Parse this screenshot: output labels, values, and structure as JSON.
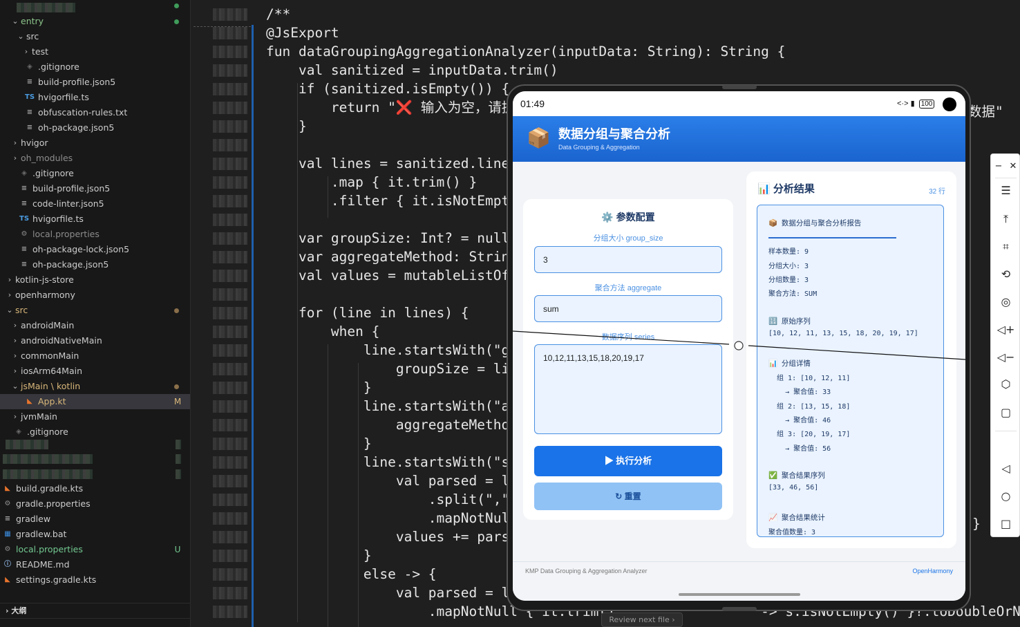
{
  "file_tree": {
    "items": [
      {
        "label": "entry",
        "indent": 1,
        "chevron": "open",
        "icon": "",
        "status_dot": "#3f9c5a",
        "color": "#8bc48a"
      },
      {
        "label": "src",
        "indent": 2,
        "chevron": "open",
        "icon": ""
      },
      {
        "label": "test",
        "indent": 3,
        "chevron": "closed",
        "icon": ""
      },
      {
        "label": ".gitignore",
        "indent": 2,
        "chevron": "",
        "icon": "gitignore"
      },
      {
        "label": "build-profile.json5",
        "indent": 2,
        "chevron": "",
        "icon": "lines"
      },
      {
        "label": "hvigorfile.ts",
        "indent": 2,
        "chevron": "",
        "icon": "ts"
      },
      {
        "label": "obfuscation-rules.txt",
        "indent": 2,
        "chevron": "",
        "icon": "lines"
      },
      {
        "label": "oh-package.json5",
        "indent": 2,
        "chevron": "",
        "icon": "lines"
      },
      {
        "label": "hvigor",
        "indent": 1,
        "chevron": "closed",
        "icon": ""
      },
      {
        "label": "oh_modules",
        "indent": 1,
        "chevron": "closed",
        "icon": "",
        "color": "#8c8c8c"
      },
      {
        "label": ".gitignore",
        "indent": 1,
        "chevron": "",
        "icon": "gitignore"
      },
      {
        "label": "build-profile.json5",
        "indent": 1,
        "chevron": "",
        "icon": "lines"
      },
      {
        "label": "code-linter.json5",
        "indent": 1,
        "chevron": "",
        "icon": "lines"
      },
      {
        "label": "hvigorfile.ts",
        "indent": 1,
        "chevron": "",
        "icon": "ts"
      },
      {
        "label": "local.properties",
        "indent": 1,
        "chevron": "",
        "icon": "gear",
        "color": "#8c8c8c"
      },
      {
        "label": "oh-package-lock.json5",
        "indent": 1,
        "chevron": "",
        "icon": "lines"
      },
      {
        "label": "oh-package.json5",
        "indent": 1,
        "chevron": "",
        "icon": "lines"
      },
      {
        "label": "kotlin-js-store",
        "indent": 0,
        "chevron": "closed",
        "icon": ""
      },
      {
        "label": "openharmony",
        "indent": 0,
        "chevron": "closed",
        "icon": ""
      },
      {
        "label": "src",
        "indent": 0,
        "chevron": "open",
        "icon": "",
        "status_dot": "#8a6f4a",
        "color": "#d9b77a"
      },
      {
        "label": "androidMain",
        "indent": 1,
        "chevron": "closed",
        "icon": ""
      },
      {
        "label": "androidNativeMain",
        "indent": 1,
        "chevron": "closed",
        "icon": ""
      },
      {
        "label": "commonMain",
        "indent": 1,
        "chevron": "closed",
        "icon": ""
      },
      {
        "label": "iosArm64Main",
        "indent": 1,
        "chevron": "closed",
        "icon": ""
      },
      {
        "label": "jsMain \\ kotlin",
        "indent": 1,
        "chevron": "open",
        "icon": "",
        "status_dot": "#8a6f4a",
        "color": "#d9b77a"
      },
      {
        "label": "App.kt",
        "indent": 2,
        "chevron": "",
        "icon": "kotlin",
        "git": "M",
        "color": "#d9b77a",
        "selected": true
      },
      {
        "label": "jvmMain",
        "indent": 1,
        "chevron": "closed",
        "icon": ""
      },
      {
        "label": ".gitignore",
        "indent": 0,
        "chevron": "",
        "icon": "gitignore"
      }
    ],
    "items_bottom": [
      {
        "label": "build.gradle.kts",
        "icon": "kotlin"
      },
      {
        "label": "gradle.properties",
        "icon": "gear"
      },
      {
        "label": "gradlew",
        "icon": "lines"
      },
      {
        "label": "gradlew.bat",
        "icon": "win"
      },
      {
        "label": "local.properties",
        "icon": "gear",
        "git": "U",
        "color": "#73c991"
      },
      {
        "label": "README.md",
        "icon": "info"
      },
      {
        "label": "settings.gradle.kts",
        "icon": "kotlin"
      }
    ],
    "outline_label": "大纲"
  },
  "editor": {
    "lines": [
      "/**",
      "@JsExport",
      "fun dataGroupingAggregationAnalyzer(inputData: String): String {",
      "    val sanitized = inputData.trim()",
      "    if (sanitized.isEmpty()) {",
      "        return \"❌ 输入为空，请提",
      "    }",
      "",
      "    val lines = sanitized.lines(",
      "        .map { it.trim() }",
      "        .filter { it.isNotEmpty(",
      "",
      "    var groupSize: Int? = null",
      "    var aggregateMethod: String?",
      "    val values = mutableListOf<D",
      "",
      "    for (line in lines) {",
      "        when {",
      "            line.startsWith(\"gro",
      "                groupSize = line",
      "            }",
      "            line.startsWith(\"agg",
      "                aggregateMethod",
      "            }",
      "            line.startsWith(\"ser",
      "                val parsed = lin",
      "                    .split(\",\",",
      "                    .mapNotNull",
      "                values += parsed",
      "            }",
      "            else -> {",
      "                val parsed = lin",
      "                    .mapNotNull { it.trim().                 -> s.isNotEmpty() }?.toDoubleOrNull() }"
    ],
    "right_fragments": [
      "数据\"",
      "}"
    ],
    "review_label": "Review next file  ›"
  },
  "phone": {
    "status": {
      "time": "01:49",
      "icons": "<·> ▮",
      "battery": "100"
    },
    "header": {
      "icon": "📦",
      "title": "数据分组与聚合分析",
      "subtitle": "Data Grouping & Aggregation"
    },
    "config": {
      "title": "⚙️ 参数配置",
      "group_label": "分组大小 group_size",
      "group_value": "3",
      "method_label": "聚合方法 aggregate",
      "method_value": "sum",
      "series_label": "数据序列 series",
      "series_value": "10,12,11,13,15,18,20,19,17",
      "run_button": "▶ 执行分析",
      "reset_button": "↻ 重置"
    },
    "results": {
      "title": "📊 分析结果",
      "count": "32 行",
      "report": [
        {
          "text": "📦  数据分组与聚合分析报告",
          "kind": "head"
        },
        {
          "text": "",
          "kind": "rule"
        },
        {
          "text": "样本数量: 9",
          "kind": "line"
        },
        {
          "text": "分组大小: 3",
          "kind": "line"
        },
        {
          "text": "分组数量: 3",
          "kind": "line"
        },
        {
          "text": "聚合方法: SUM",
          "kind": "line"
        },
        {
          "text": "",
          "kind": "blank"
        },
        {
          "text": "🔢  原始序列",
          "kind": "head"
        },
        {
          "text": "[10, 12, 11, 13, 15, 18, 20, 19, 17]",
          "kind": "line"
        },
        {
          "text": "",
          "kind": "blank"
        },
        {
          "text": "📊  分组详情",
          "kind": "head"
        },
        {
          "text": "  组 1: [10, 12, 11]",
          "kind": "line"
        },
        {
          "text": "    → 聚合值: 33",
          "kind": "line"
        },
        {
          "text": "  组 2: [13, 15, 18]",
          "kind": "line"
        },
        {
          "text": "    → 聚合值: 46",
          "kind": "line"
        },
        {
          "text": "  组 3: [20, 19, 17]",
          "kind": "line"
        },
        {
          "text": "    → 聚合值: 56",
          "kind": "line"
        },
        {
          "text": "",
          "kind": "blank"
        },
        {
          "text": "✅  聚合结果序列",
          "kind": "head"
        },
        {
          "text": "[33, 46, 56]",
          "kind": "line"
        },
        {
          "text": "",
          "kind": "blank"
        },
        {
          "text": "📈  聚合结果统计",
          "kind": "head"
        },
        {
          "text": "聚合值数量: 3",
          "kind": "line"
        }
      ]
    },
    "footer": {
      "left": "KMP Data Grouping & Aggregation Analyzer",
      "right": "OpenHarmony"
    }
  },
  "toolbar": {
    "buttons": [
      {
        "glyph": "−",
        "name": "minimize-icon"
      },
      {
        "glyph": "✕",
        "name": "close-icon"
      },
      {
        "glyph": "☰",
        "name": "menu-icon"
      },
      {
        "glyph": "⤒",
        "name": "pin-top-icon"
      },
      {
        "glyph": "⌗",
        "name": "crop-icon"
      },
      {
        "glyph": "⟲",
        "name": "rotate-icon"
      },
      {
        "glyph": "◎",
        "name": "location-icon"
      },
      {
        "glyph": "◁+",
        "name": "volume-up-icon"
      },
      {
        "glyph": "◁−",
        "name": "volume-down-icon"
      },
      {
        "glyph": "⬡",
        "name": "shake-icon"
      },
      {
        "glyph": "▢",
        "name": "screenshot-icon"
      },
      {
        "glyph": "◁",
        "name": "back-icon"
      },
      {
        "glyph": "○",
        "name": "home-icon"
      },
      {
        "glyph": "□",
        "name": "recents-icon"
      }
    ]
  }
}
